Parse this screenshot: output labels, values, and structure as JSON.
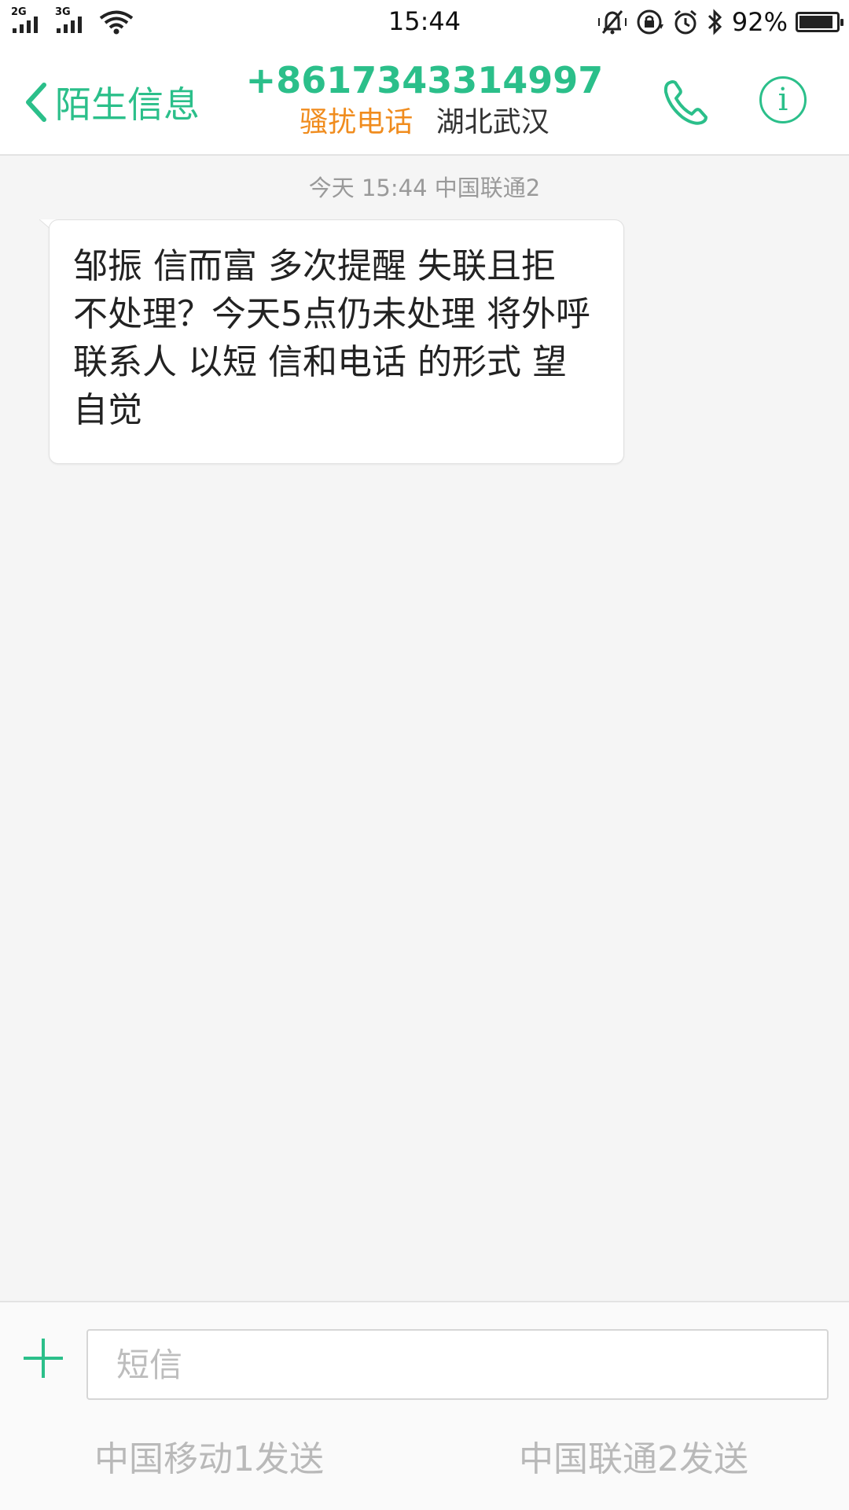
{
  "status_bar": {
    "signal_1_type": "2G",
    "signal_2_type": "3G",
    "time": "15:44",
    "battery_percent": "92%",
    "battery_level": 0.92,
    "icons": [
      "wifi-icon",
      "mute-icon",
      "rotation-lock-icon",
      "alarm-icon",
      "bluetooth-icon",
      "battery-icon"
    ]
  },
  "header": {
    "back_label": "陌生信息",
    "phone_number": "+8617343314997",
    "tag": "骚扰电话",
    "location": "湖北武汉",
    "accent_color": "#2bbf8a",
    "tag_color": "#f08c1e"
  },
  "conversation": {
    "meta": "今天 15:44  中国联通2",
    "messages": [
      {
        "lines": [
          "邹振  信而富  多次提醒 失联且拒",
          "不处理？今天5点仍未处理 将外呼",
          "联系人 以短 信和电话  的形式 望",
          "自觉"
        ]
      }
    ]
  },
  "compose": {
    "input_value": "",
    "input_placeholder": "短信",
    "send_sim1_label": "中国移动1发送",
    "send_sim2_label": "中国联通2发送"
  }
}
